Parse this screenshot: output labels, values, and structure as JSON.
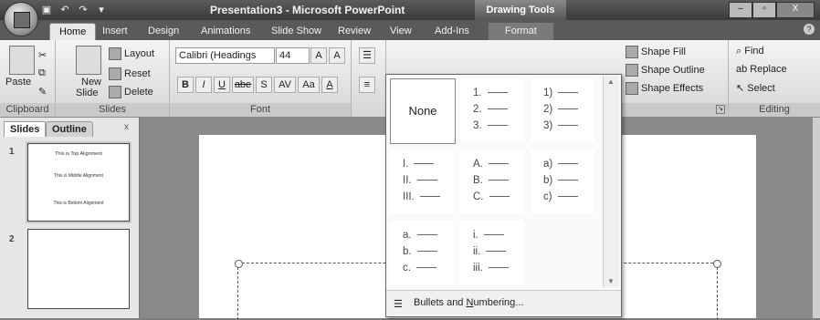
{
  "window": {
    "title": "Presentation3 - Microsoft PowerPoint",
    "context_tab_header": "Drawing Tools",
    "buttons": [
      "–",
      "▫",
      "X"
    ]
  },
  "tabs": [
    "Home",
    "Insert",
    "Design",
    "Animations",
    "Slide Show",
    "Review",
    "View",
    "Add-Ins",
    "Format"
  ],
  "active_tab": "Home",
  "ribbon": {
    "clipboard": {
      "paste": "Paste",
      "label": "Clipboard"
    },
    "slides": {
      "new_slide": "New",
      "new_slide2": "Slide",
      "layout": "Layout",
      "reset": "Reset",
      "delete": "Delete",
      "label": "Slides"
    },
    "font": {
      "font_name": "Calibri (Headings",
      "font_size": "44",
      "bold": "B",
      "italic": "I",
      "underline": "U",
      "strike": "abe",
      "shadow": "S",
      "spacing": "AV",
      "case": "Aa",
      "color": "A",
      "label": "Font"
    },
    "drawing": {
      "shape_fill": "Shape Fill",
      "shape_outline": "Shape Outline",
      "shape_effects": "Shape Effects"
    },
    "editing": {
      "find": "Find",
      "replace": "Replace",
      "select": "Select",
      "label": "Editing"
    }
  },
  "slides_panel": {
    "tab_slides": "Slides",
    "tab_outline": "Outline",
    "close": "x",
    "thumbnails": [
      {
        "number": "1",
        "lines": [
          "This is Top Alignment",
          "This is Middle Alignment",
          "This is Bottom Alignment"
        ]
      },
      {
        "number": "2",
        "lines": []
      }
    ]
  },
  "numbering_gallery": {
    "none_label": "None",
    "styles": [
      [
        "1.",
        "2.",
        "3."
      ],
      [
        "1)",
        "2)",
        "3)"
      ],
      [
        "I.",
        "II.",
        "III."
      ],
      [
        "A.",
        "B.",
        "C."
      ],
      [
        "a)",
        "b)",
        "c)"
      ],
      [
        "a.",
        "b.",
        "c."
      ],
      [
        "i.",
        "ii.",
        "iii."
      ]
    ],
    "footer_pre": "Bullets and ",
    "footer_u": "N",
    "footer_post": "umbering..."
  }
}
